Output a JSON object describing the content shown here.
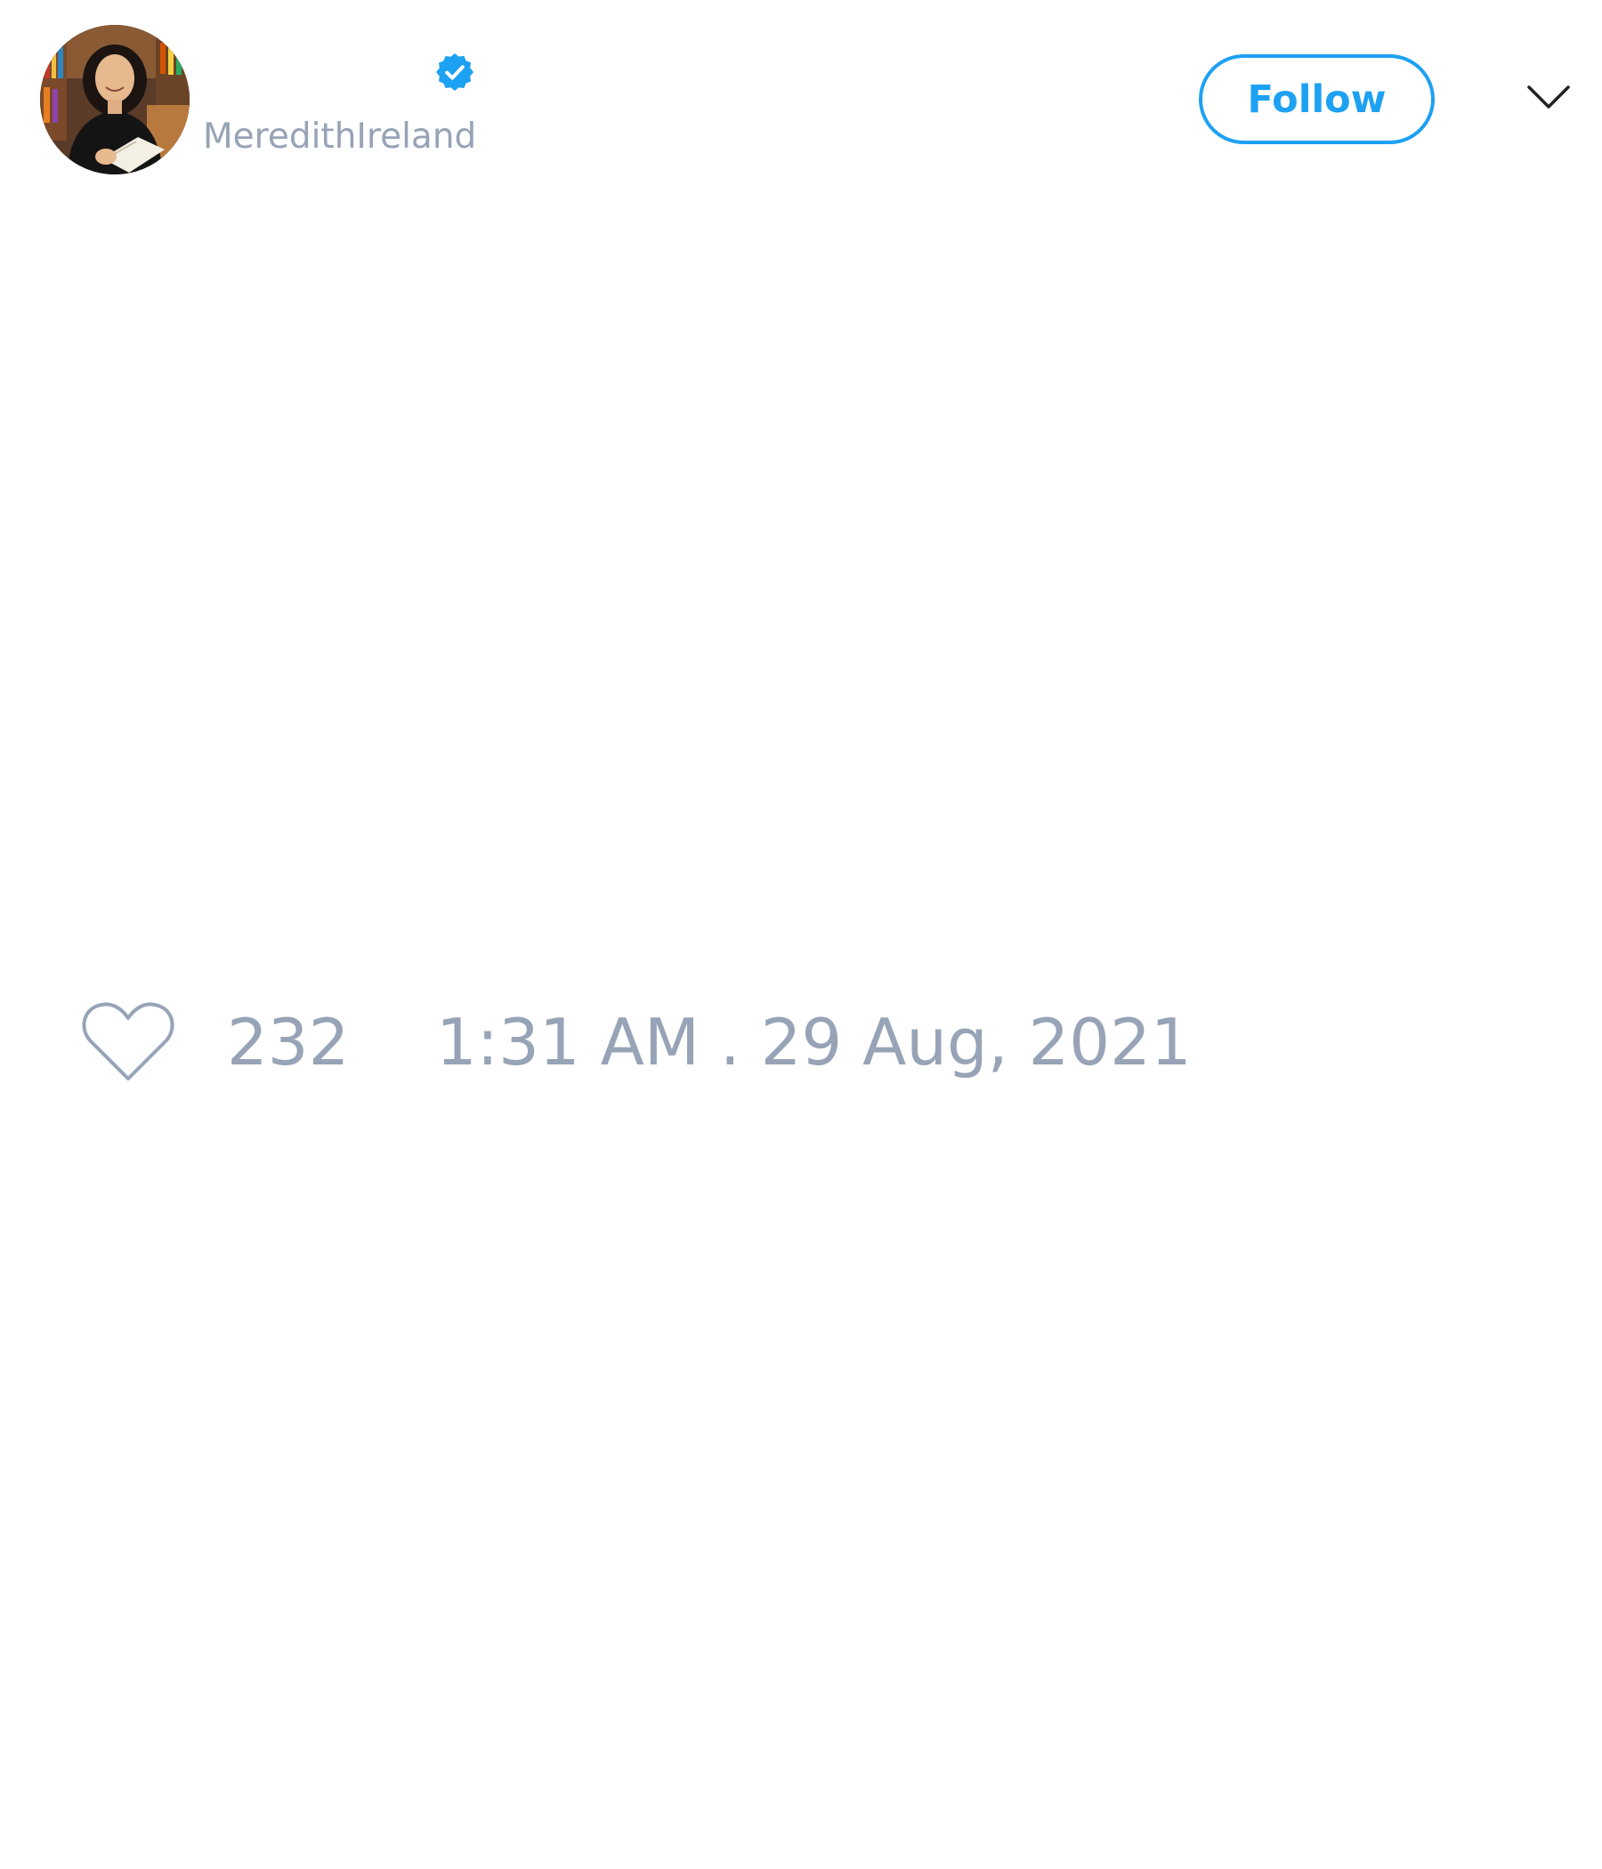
{
  "author": {
    "display_name": "",
    "handle": "MeredithIreland",
    "avatar_icon": "profile-photo",
    "verified_icon": "verified-badge-icon",
    "verified_color": "#1da1f2"
  },
  "header": {
    "follow_label": "Follow",
    "menu_icon": "chevron-down-icon"
  },
  "footer": {
    "like_icon": "heart-icon",
    "like_count": "232",
    "timestamp": "1:31 AM . 29 Aug, 2021"
  },
  "colors": {
    "accent": "#1da1f2",
    "muted_text": "#97a3b6",
    "background": "#ffffff"
  }
}
